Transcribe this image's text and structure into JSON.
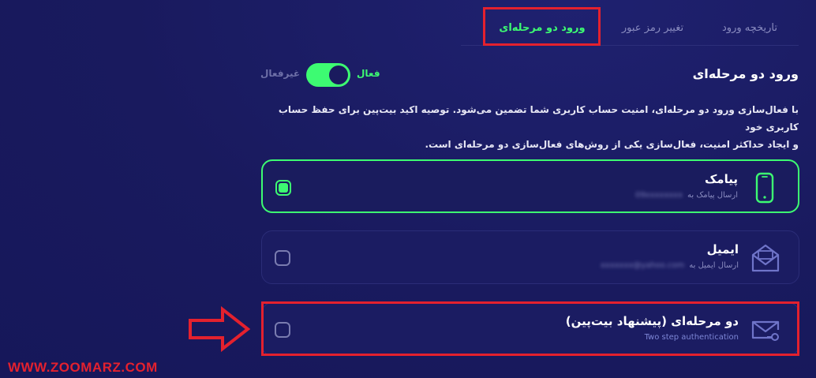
{
  "tabs": [
    {
      "label": "تاریخچه ورود",
      "active": false
    },
    {
      "label": "تغییر رمز عبور",
      "active": false
    },
    {
      "label": "ورود دو مرحله‌ای",
      "active": true
    }
  ],
  "section": {
    "title": "ورود دو مرحله‌ای",
    "toggle_on_label": "فعال",
    "toggle_off_label": "غیرفعال",
    "enabled": true,
    "description_line1": "با فعال‌سازی ورود دو مرحله‌ای، امنیت حساب کاربری شما تضمین می‌شود. توصیه اکید بیت‌پین برای حفظ حساب کاربری خود",
    "description_line2": "و ایجاد حداکثر امنیت، فعال‌سازی یکی از روش‌های فعال‌سازی دو مرحله‌ای است."
  },
  "methods": [
    {
      "title": "پیامک",
      "subtitle": "ارسال پیامک به",
      "masked": "09xxxxxxxx",
      "icon": "phone-icon",
      "selected": true
    },
    {
      "title": "ایمیل",
      "subtitle": "ارسال ایمیل به",
      "masked": "xxxxxxx@yahoo.com",
      "icon": "envelope-open-icon",
      "selected": false
    },
    {
      "title": "دو مرحله‌ای (پیشنهاد بیت‌پین)",
      "subtitle": "Two step authentication",
      "icon": "envelope-key-icon",
      "selected": false
    }
  ],
  "watermark": "WWW.ZOOMARZ.COM",
  "colors": {
    "accent": "#3dfb72",
    "background": "#191a5e",
    "annotation": "#e4212e"
  }
}
